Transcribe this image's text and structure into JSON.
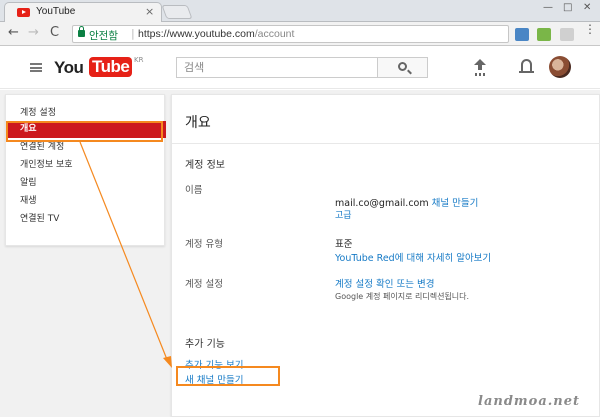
{
  "browser": {
    "tab_title": "YouTube",
    "tab_close": "×",
    "win_min": "—",
    "win_max": "□",
    "win_close": "✕",
    "back": "←",
    "forward": "→",
    "reload": "C",
    "secure_label": "안전함",
    "url_host": "https://www.youtube.com",
    "url_path": "/account",
    "star": "☆",
    "menu": "⋮"
  },
  "header": {
    "logo_you": "You",
    "logo_tube": "Tube",
    "country": "KR",
    "search_placeholder": "검색"
  },
  "sidebar": {
    "heading": "계정 설정",
    "items": [
      {
        "label": "개요",
        "active": true
      },
      {
        "label": "연결된 계정"
      },
      {
        "label": "개인정보 보호"
      },
      {
        "label": "알림"
      },
      {
        "label": "재생"
      },
      {
        "label": "연결된 TV"
      }
    ]
  },
  "main": {
    "title": "개요",
    "account_info_heading": "계정 정보",
    "name_label": "이름",
    "email": "mail.co@gmail.com",
    "create_channel_link": "채널 만들기",
    "advanced_link": "고급",
    "account_type_label": "계정 유형",
    "account_type_value": "표준",
    "red_link": "YouTube Red에 대해 자세히 알아보기",
    "account_settings_label": "계정 설정",
    "settings_link": "계정 설정 확인 또는 변경",
    "settings_note": "Google 계정 페이지로 리디렉션됩니다.",
    "extra_heading": "추가 기능",
    "extra_link": "추가 기능 보기",
    "new_channel_link": "새 채널 만들기"
  },
  "watermark": "landmoa.net",
  "colors": {
    "accent_red": "#cc181e",
    "link_blue": "#167ac6",
    "highlight_orange": "#f5891f"
  }
}
